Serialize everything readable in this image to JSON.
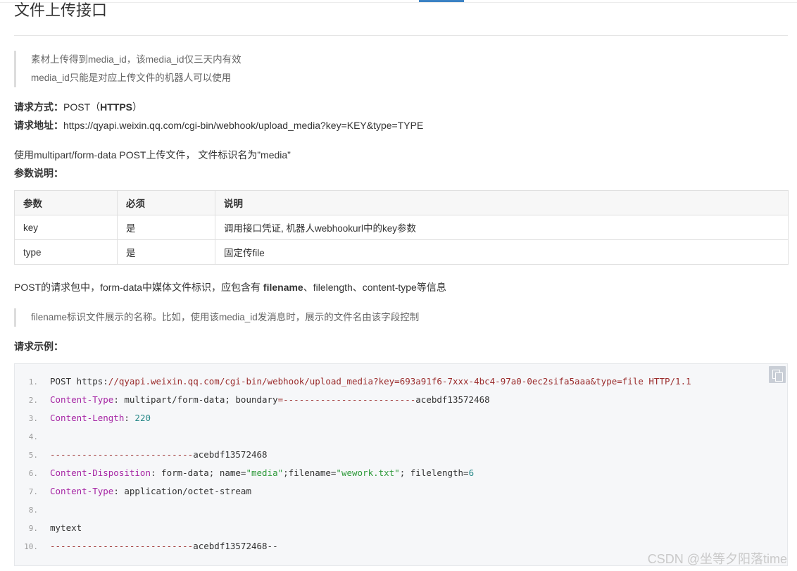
{
  "page": {
    "title": "文件上传接口"
  },
  "quote1": {
    "line1": "素材上传得到media_id，该media_id仅三天内有效",
    "line2": "media_id只能是对应上传文件的机器人可以使用"
  },
  "request": {
    "method_label": "请求方式：",
    "method_value": "POST（",
    "method_bold": "HTTPS",
    "method_close": "）",
    "url_label": "请求地址：",
    "url_value": "https://qyapi.weixin.qq.com/cgi-bin/webhook/upload_media?key=KEY&type=TYPE"
  },
  "multipart_note": "使用multipart/form-data POST上传文件， 文件标识名为”media”",
  "params_label": "参数说明：",
  "params_table": {
    "headers": [
      "参数",
      "必须",
      "说明"
    ],
    "rows": [
      [
        "key",
        "是",
        "调用接口凭证, 机器人webhookurl中的key参数"
      ],
      [
        "type",
        "是",
        "固定传file"
      ]
    ]
  },
  "post_note": {
    "prefix": "POST的请求包中，form-data中媒体文件标识，应包含有 ",
    "bold": "filename",
    "suffix": "、filelength、content-type等信息"
  },
  "quote2": {
    "line1": "filename标识文件展示的名称。比如，使用该media_id发消息时，展示的文件名由该字段控制"
  },
  "example_label": "请求示例：",
  "code": {
    "line_numbers": [
      "1.",
      "2.",
      "3.",
      "4.",
      "5.",
      "6.",
      "7.",
      "8.",
      "9.",
      "10."
    ],
    "l1_a": "POST https:",
    "l1_b": "//qyapi.weixin.qq.com/cgi-bin/webhook/upload_media?key=693a91f6-7xxx-4bc4-97a0-0ec2sifa5aaa&type=file HTTP/1.1",
    "l2_key": "Content-Type",
    "l2_a": ": multipart/form-data; boundary",
    "l2_b": "=-------------------------",
    "l2_c": "acebdf13572468",
    "l3_key": "Content-Length",
    "l3_a": ": ",
    "l3_num": "220",
    "l5_a": "---------------------------",
    "l5_b": "acebdf13572468",
    "l6_key": "Content-Disposition",
    "l6_a": ": form-data; name=",
    "l6_s1": "\"media\"",
    "l6_b": ";filename=",
    "l6_s2": "\"wework.txt\"",
    "l6_c": "; filelength=",
    "l6_num": "6",
    "l7_key": "Content-Type",
    "l7_a": ": application/octet-stream",
    "l9_a": "mytext",
    "l10_a": "---------------------------",
    "l10_b": "acebdf13572468--"
  },
  "watermark": "CSDN @坐等夕阳落time"
}
